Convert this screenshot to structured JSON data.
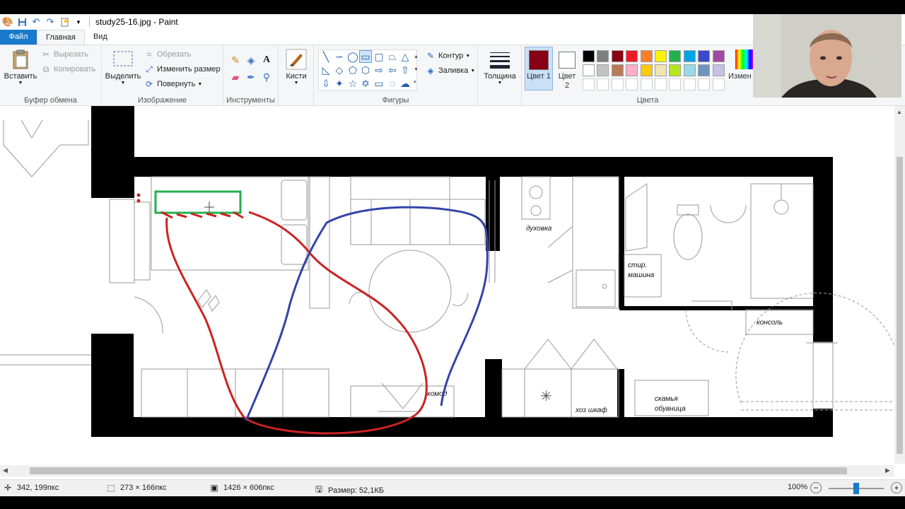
{
  "window": {
    "title": "study25-16.jpg - Paint"
  },
  "tabs": [
    {
      "label": "Файл"
    },
    {
      "label": "Главная"
    },
    {
      "label": "Вид"
    }
  ],
  "ribbon": {
    "clipboard": {
      "paste": "Вставить",
      "cut": "Вырезать",
      "copy": "Копировать",
      "label": "Буфер обмена"
    },
    "image": {
      "select": "Выделить",
      "crop": "Обрезать",
      "resize": "Изменить размер",
      "rotate": "Повернуть",
      "label": "Изображение"
    },
    "tools": {
      "label": "Инструменты"
    },
    "brushes": {
      "label": "Кисти"
    },
    "shapes": {
      "outline": "Контур",
      "fill": "Заливка",
      "label": "Фигуры"
    },
    "size": {
      "label": "Толщина"
    },
    "colors": {
      "color1": "Цвет 1",
      "color2": "Цвет 2",
      "edit": "Измен цвет",
      "label": "Цвета",
      "color1_value": "#880015",
      "color2_value": "#ffffff",
      "palette_row1": [
        "#000000",
        "#7f7f7f",
        "#880015",
        "#ed1c24",
        "#ff7f27",
        "#fff200",
        "#22b14c",
        "#00a2e8",
        "#3f48cc",
        "#a349a4"
      ],
      "palette_row2": [
        "#ffffff",
        "#c3c3c3",
        "#b97a57",
        "#ffaec9",
        "#ffc90e",
        "#efe4b0",
        "#b5e61d",
        "#99d9ea",
        "#7092be",
        "#c8bfe7"
      ]
    }
  },
  "floorplan": {
    "labels": {
      "oven": "духовка",
      "washer_line1": "стир.",
      "washer_line2": "машина",
      "console": "консоль",
      "dresser": "комод",
      "storage": "хоз шкаф",
      "bench_line1": "скамья",
      "bench_line2": "обувница"
    },
    "annotation_colors": {
      "green": "#22b14c",
      "red": "#cc2222",
      "blue": "#3344aa"
    }
  },
  "status": {
    "cursor": "342, 199пкс",
    "selection": "273 × 166пкс",
    "image_size": "1426 × 606пкс",
    "file_size": "Размер: 52,1КБ",
    "zoom": "100%"
  }
}
